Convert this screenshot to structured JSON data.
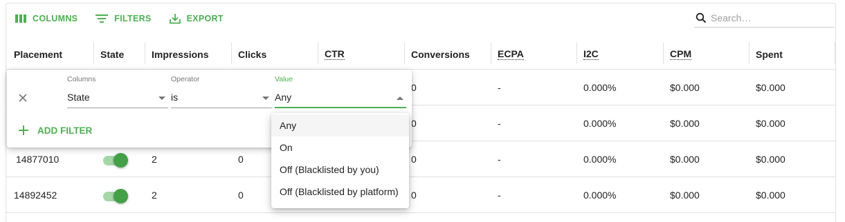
{
  "toolbar": {
    "columns_label": "COLUMNS",
    "filters_label": "FILTERS",
    "export_label": "EXPORT",
    "search_placeholder": "Search…"
  },
  "accent_color": "#4caf50",
  "columns": [
    "Placement",
    "State",
    "Impressions",
    "Clicks",
    "CTR",
    "Conversions",
    "ECPA",
    "I2C",
    "CPM",
    "Spent"
  ],
  "rows": [
    {
      "placement": "",
      "state": "on",
      "impressions": "",
      "clicks": "",
      "ctr": "",
      "conversions": "0",
      "ecpa": "-",
      "i2c": "0.000%",
      "cpm": "$0.000",
      "spent": "$0.000"
    },
    {
      "placement": "",
      "state": "on",
      "impressions": "",
      "clicks": "",
      "ctr": "",
      "conversions": "0",
      "ecpa": "-",
      "i2c": "0.000%",
      "cpm": "$0.000",
      "spent": "$0.000"
    },
    {
      "placement": "14877010",
      "state": "on",
      "impressions": "2",
      "clicks": "0",
      "ctr": "",
      "conversions": "0",
      "ecpa": "-",
      "i2c": "0.000%",
      "cpm": "$0.000",
      "spent": "$0.000"
    },
    {
      "placement": "14892452",
      "state": "on",
      "impressions": "2",
      "clicks": "0",
      "ctr": "",
      "conversions": "0",
      "ecpa": "-",
      "i2c": "0.000%",
      "cpm": "$0.000",
      "spent": "$0.000"
    }
  ],
  "filter": {
    "columns_label": "Columns",
    "columns_value": "State",
    "operator_label": "Operator",
    "operator_value": "is",
    "value_label": "Value",
    "value_value": "Any",
    "add_filter_label": "ADD FILTER"
  },
  "value_options": [
    "Any",
    "On",
    "Off (Blacklisted by you)",
    "Off (Blacklisted by platform)"
  ],
  "selected_option": "Any"
}
